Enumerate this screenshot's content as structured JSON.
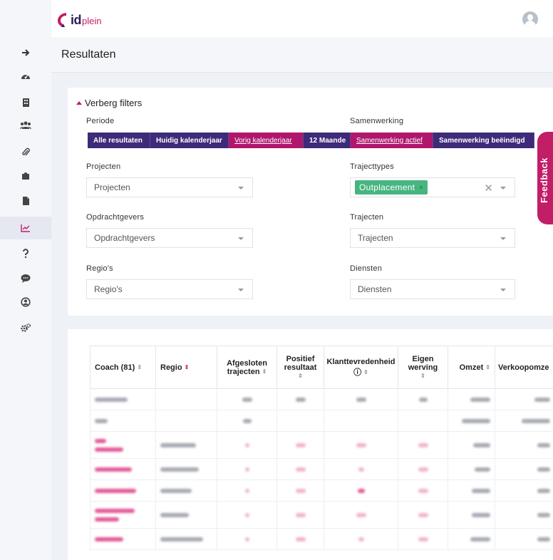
{
  "brand": {
    "id": "id",
    "plein": "plein"
  },
  "page": {
    "title": "Resultaten"
  },
  "sidebar": {
    "items": [
      {
        "icon": "arrow-right-icon"
      },
      {
        "icon": "dashboard-icon"
      },
      {
        "icon": "building-icon"
      },
      {
        "icon": "users-icon"
      },
      {
        "icon": "paperclip-icon"
      },
      {
        "icon": "puzzle-icon"
      },
      {
        "icon": "document-icon"
      },
      {
        "icon": "chart-line-icon",
        "active": true
      },
      {
        "icon": "question-icon"
      },
      {
        "icon": "chat-icon"
      },
      {
        "icon": "user-circle-icon"
      },
      {
        "icon": "gears-icon"
      }
    ]
  },
  "filters": {
    "toggle_label": "Verberg filters",
    "periode": {
      "label": "Periode",
      "options": [
        "Alle resultaten",
        "Huidig kalenderjaar",
        "Vorig kalenderjaar",
        "12 Maande"
      ],
      "active": "Vorig kalenderjaar"
    },
    "samenwerking": {
      "label": "Samenwerking",
      "options": [
        "Samenwerking actief",
        "Samenwerking beëindigd"
      ],
      "active": "Samenwerking actief"
    },
    "projecten": {
      "label": "Projecten",
      "placeholder": "Projecten"
    },
    "trajecttypes": {
      "label": "Trajecttypes",
      "tag": "Outplacement",
      "tag_remove": "×",
      "clear": "✕"
    },
    "opdrachtgevers": {
      "label": "Opdrachtgevers",
      "placeholder": "Opdrachtgevers"
    },
    "trajecten": {
      "label": "Trajecten",
      "placeholder": "Trajecten"
    },
    "regios": {
      "label": "Regio's",
      "placeholder": "Regio's"
    },
    "diensten": {
      "label": "Diensten",
      "placeholder": "Diensten"
    }
  },
  "feedback": {
    "label": "Feedback"
  },
  "table": {
    "columns": {
      "coach": "Coach (81)",
      "regio": "Regio",
      "afgesloten": "Afgesloten trajecten",
      "positief": "Positief resultaat",
      "klant": "Klanttevredenheid",
      "eigen": "Eigen werving",
      "omzet": "Omzet",
      "verkoop": "Verkoopomze"
    },
    "sort_icon": "⇕",
    "info_icon": "ⓘ"
  },
  "colors": {
    "brand_purple": "#3d2a78",
    "brand_pink": "#c21d67",
    "tag_green": "#47b580"
  }
}
